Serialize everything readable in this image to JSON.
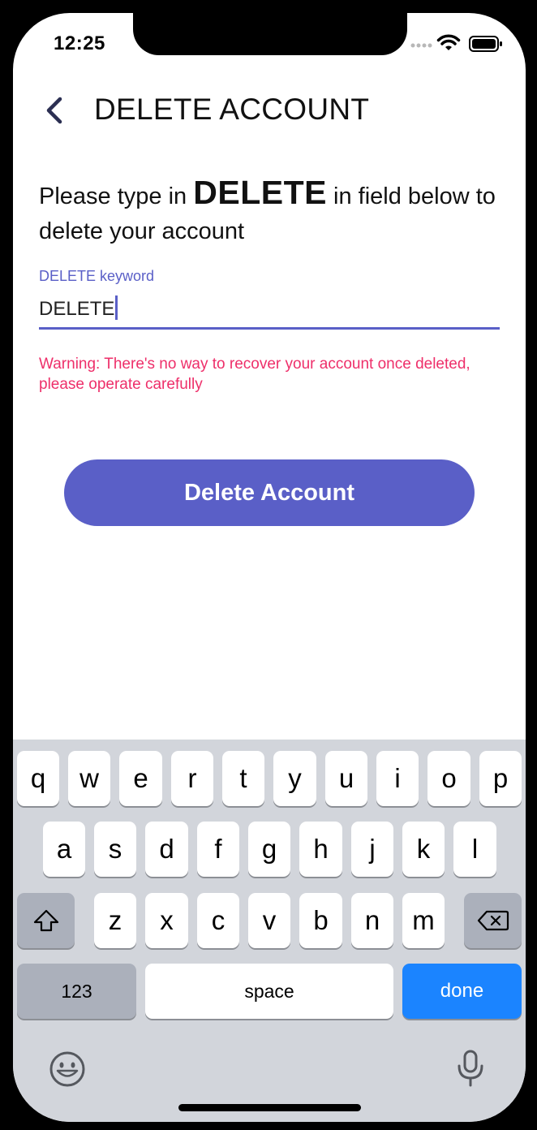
{
  "status_bar": {
    "time": "12:25"
  },
  "header": {
    "title": "DELETE ACCOUNT",
    "back_icon": "chevron-left-icon"
  },
  "instruction": {
    "prefix": "Please type in ",
    "keyword": "DELETE",
    "suffix": " in field below to delete your account"
  },
  "form": {
    "label": "DELETE keyword",
    "value": "DELETE",
    "warning": "Warning: There's no way to recover your account once deleted, please operate carefully"
  },
  "delete_button": {
    "label": "Delete Account"
  },
  "keyboard": {
    "row1": [
      "q",
      "w",
      "e",
      "r",
      "t",
      "y",
      "u",
      "i",
      "o",
      "p"
    ],
    "row2": [
      "a",
      "s",
      "d",
      "f",
      "g",
      "h",
      "j",
      "k",
      "l"
    ],
    "row3": [
      "z",
      "x",
      "c",
      "v",
      "b",
      "n",
      "m"
    ],
    "numbers_label": "123",
    "space_label": "space",
    "done_label": "done",
    "shift_icon": "shift-icon",
    "backspace_icon": "backspace-icon",
    "emoji_icon": "emoji-icon",
    "mic_icon": "microphone-icon"
  },
  "colors": {
    "accent": "#5a5fc7",
    "warning": "#ee2f6a",
    "done_key": "#1b84ff",
    "keyboard_bg": "#d2d5db"
  }
}
